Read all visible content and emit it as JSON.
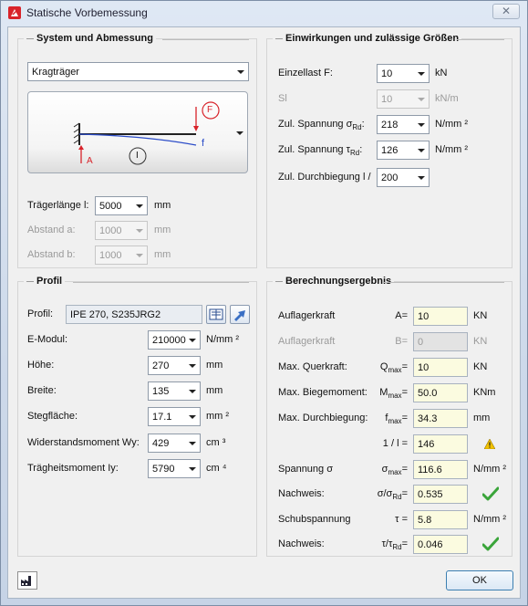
{
  "window": {
    "title": "Statische Vorbemessung",
    "close_glyph": "✕",
    "icon": "allplan-app-icon"
  },
  "system": {
    "title": "System und Abmessung",
    "system_type": "Kragträger",
    "diagram": {
      "label_F": "F",
      "label_A": "A",
      "label_f": "f",
      "label_I": "I"
    },
    "traegerlaenge_label": "Trägerlänge l:",
    "traegerlaenge_value": "5000",
    "traegerlaenge_unit": "mm",
    "abstand_a_label": "Abstand a:",
    "abstand_a_value": "1000",
    "abstand_a_unit": "mm",
    "abstand_b_label": "Abstand b:",
    "abstand_b_value": "1000",
    "abstand_b_unit": "mm"
  },
  "einwirkungen": {
    "title": "Einwirkungen und zulässige Größen",
    "einzellast_label": "Einzellast F:",
    "einzellast_value": "10",
    "einzellast_unit": "kN",
    "streckenlast_label": "Sl",
    "streckenlast_value": "10",
    "streckenlast_unit": "kN/m",
    "zul_sigma_label": "Zul. Spannung σ",
    "zul_sigma_sub": "Rd",
    "zul_sigma_value": "218",
    "zul_sigma_unit": "N/mm ²",
    "zul_tau_label": "Zul. Spannung τ",
    "zul_tau_sub": "Rd",
    "zul_tau_value": "126",
    "zul_tau_unit": "N/mm ²",
    "zul_durchbiegung_label": "Zul. Durchbiegung l /",
    "zul_durchbiegung_value": "200"
  },
  "profil": {
    "title": "Profil",
    "profil_label": "Profil:",
    "profil_value": "IPE 270, S235JRG2",
    "emodul_label": "E-Modul:",
    "emodul_value": "210000",
    "emodul_unit": "N/mm ²",
    "hoehe_label": "Höhe:",
    "hoehe_value": "270",
    "hoehe_unit": "mm",
    "breite_label": "Breite:",
    "breite_value": "135",
    "breite_unit": "mm",
    "stegflaeche_label": "Stegfläche:",
    "stegflaeche_value": "17.1",
    "stegflaeche_unit": "mm ²",
    "wy_label": "Widerstandsmoment Wy:",
    "wy_value": "429",
    "wy_unit": "cm ³",
    "iy_label": "Trägheitsmoment Iy:",
    "iy_value": "5790",
    "iy_unit": "cm ⁴"
  },
  "ergebnis": {
    "title": "Berechnungsergebnis",
    "rows": [
      {
        "label": "Auflagerkraft",
        "sym": "A=",
        "value": "10",
        "unit": "KN",
        "disabled": false
      },
      {
        "label": "Auflagerkraft",
        "sym": "B=",
        "value": "0",
        "unit": "KN",
        "disabled": true
      },
      {
        "label": "Max. Querkraft:",
        "sym": "Q",
        "sub": "max",
        "value": "10",
        "unit": "KN",
        "disabled": false
      },
      {
        "label": "Max. Biegemoment:",
        "sym": "M",
        "sub": "max",
        "value": "50.0",
        "unit": "KNm",
        "disabled": false
      },
      {
        "label": "Max. Durchbiegung:",
        "sym": "f",
        "sub": "max",
        "value": "34.3",
        "unit": "mm",
        "disabled": false
      },
      {
        "label": "",
        "sym": "1 / l =",
        "value": "146",
        "unit": "",
        "disabled": false
      },
      {
        "label": "Spannung σ",
        "sym": "σ",
        "sub": "max",
        "value": "116.6",
        "unit": "N/mm ²",
        "disabled": false
      },
      {
        "label": "Nachweis:",
        "sym": "σ/σ",
        "sub": "Rd",
        "value": "0.535",
        "unit": "",
        "disabled": false
      },
      {
        "label": "Schubspannung",
        "sym": "τ =",
        "value": "5.8",
        "unit": "N/mm ²",
        "disabled": false
      },
      {
        "label": "Nachweis:",
        "sym": "τ/τ",
        "sub": "Rd",
        "value": "0.046",
        "unit": "",
        "disabled": false
      }
    ]
  },
  "footer": {
    "ok_label": "OK"
  },
  "colors": {
    "accent_red": "#d8232a",
    "check_green": "#3aa53a",
    "warning_yellow": "#f2c200",
    "result_field_bg": "#fbfbe0"
  }
}
